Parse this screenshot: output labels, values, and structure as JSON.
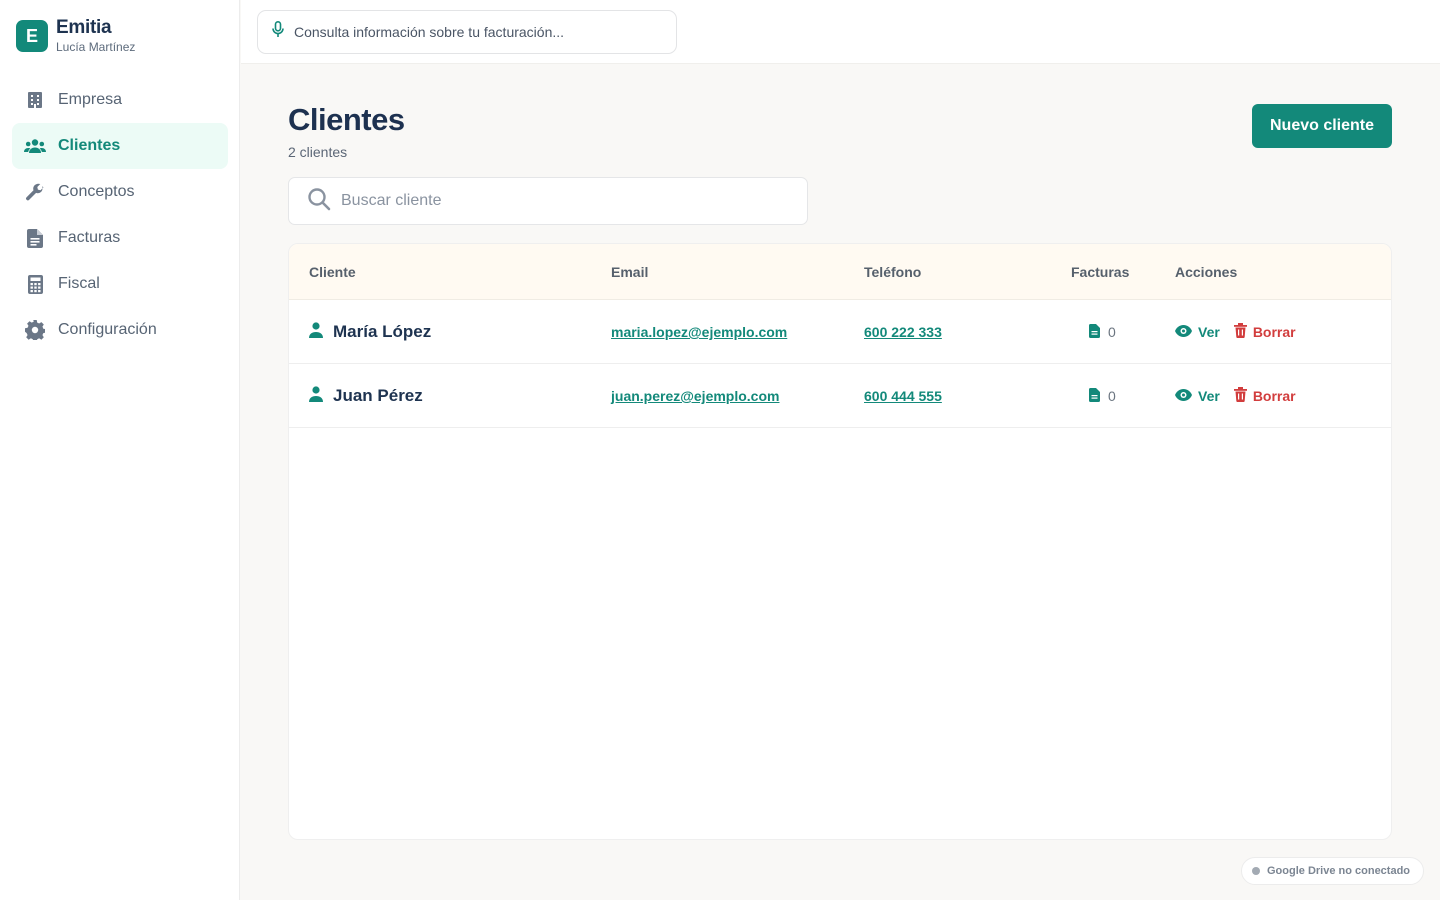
{
  "brand": {
    "logo_letter": "E",
    "name": "Emitia",
    "user": "Lucía Martínez"
  },
  "sidebar": {
    "items": [
      {
        "label": "Empresa",
        "icon": "building-icon",
        "active": false
      },
      {
        "label": "Clientes",
        "icon": "users-icon",
        "active": true
      },
      {
        "label": "Conceptos",
        "icon": "wrench-icon",
        "active": false
      },
      {
        "label": "Facturas",
        "icon": "document-icon",
        "active": false
      },
      {
        "label": "Fiscal",
        "icon": "calculator-icon",
        "active": false
      },
      {
        "label": "Configuración",
        "icon": "gear-icon",
        "active": false
      }
    ]
  },
  "topbar": {
    "assistant_placeholder": "Consulta información sobre tu facturación..."
  },
  "main": {
    "title": "Clientes",
    "subtitle": "2 clientes",
    "new_button": "Nuevo cliente",
    "search_placeholder": "Buscar cliente"
  },
  "table": {
    "columns": [
      "Cliente",
      "Email",
      "Teléfono",
      "Facturas",
      "Acciones"
    ],
    "rows": [
      {
        "name": "María López",
        "email": "maria.lopez@ejemplo.com",
        "phone": "600 222 333",
        "invoices": "0",
        "view": "Ver",
        "delete": "Borrar"
      },
      {
        "name": "Juan Pérez",
        "email": "juan.perez@ejemplo.com",
        "phone": "600 444 555",
        "invoices": "0",
        "view": "Ver",
        "delete": "Borrar"
      }
    ]
  },
  "status": {
    "drive": "Google Drive no conectado"
  },
  "colors": {
    "accent": "#13897a",
    "danger": "#d23d3d",
    "title": "#1d3150"
  }
}
